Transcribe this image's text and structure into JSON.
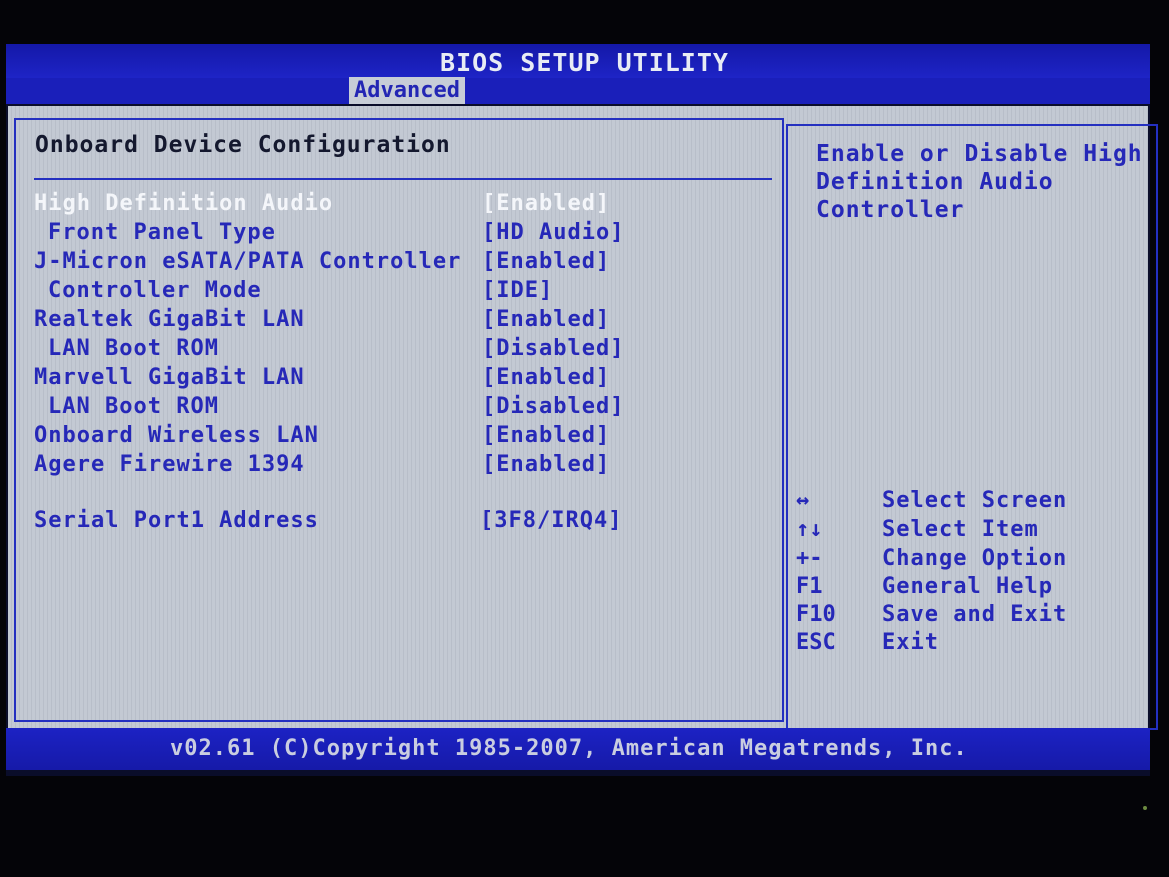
{
  "header": {
    "title": "BIOS SETUP UTILITY",
    "active_tab": "Advanced"
  },
  "section": {
    "title": "Onboard Device Configuration"
  },
  "settings": [
    {
      "label": "High Definition Audio",
      "value": "[Enabled]",
      "selected": true
    },
    {
      "label": "Front Panel Type",
      "value": "[HD Audio]"
    },
    {
      "label": "J-Micron eSATA/PATA Controller",
      "value": "[Enabled]"
    },
    {
      "label": "Controller Mode",
      "value": "[IDE]"
    },
    {
      "label": "Realtek GigaBit LAN",
      "value": "[Enabled]"
    },
    {
      "label": "LAN Boot ROM",
      "value": "[Disabled]"
    },
    {
      "label": "Marvell GigaBit LAN",
      "value": "[Enabled]"
    },
    {
      "label": "LAN Boot ROM",
      "value": "[Disabled]"
    },
    {
      "label": "Onboard Wireless LAN",
      "value": "[Enabled]"
    },
    {
      "label": "Agere Firewire 1394",
      "value": "[Enabled]"
    },
    {
      "label": "Serial Port1 Address",
      "value": "[3F8/IRQ4]"
    }
  ],
  "help": {
    "text": "Enable or Disable High Definition Audio Controller"
  },
  "keys": [
    {
      "key": "↔",
      "desc": "Select Screen"
    },
    {
      "key": "↑↓",
      "desc": "Select Item"
    },
    {
      "key": "+-",
      "desc": "Change Option"
    },
    {
      "key": "F1",
      "desc": "General Help"
    },
    {
      "key": "F10",
      "desc": "Save and Exit"
    },
    {
      "key": "ESC",
      "desc": "Exit"
    }
  ],
  "footer": {
    "text": "v02.61 (C)Copyright 1985-2007, American Megatrends, Inc."
  },
  "colors": {
    "panel_background": "#c3c9d3",
    "bar_blue": "#1a1fba",
    "text_blue": "#2628b8",
    "selected_text": "#f4f6fa"
  }
}
